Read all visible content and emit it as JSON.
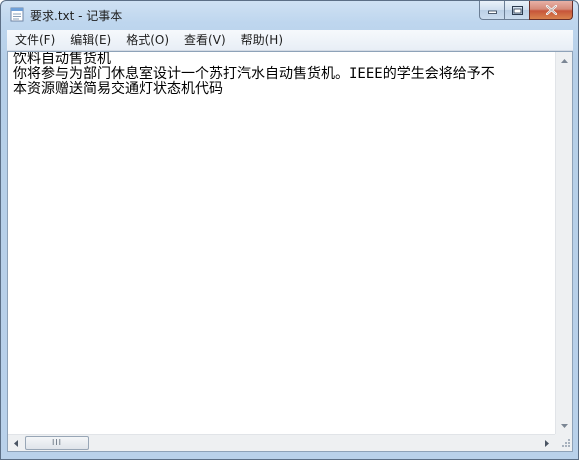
{
  "window": {
    "title": "要求.txt - 记事本"
  },
  "menubar": {
    "items": [
      {
        "label": "文件(F)"
      },
      {
        "label": "编辑(E)"
      },
      {
        "label": "格式(O)"
      },
      {
        "label": "查看(V)"
      },
      {
        "label": "帮助(H)"
      }
    ]
  },
  "document": {
    "lines": [
      "饮料自动售货机",
      "你将参与为部门休息室设计一个苏打汽水自动售货机。IEEE的学生会将给予不",
      "本资源赠送简易交通灯状态机代码"
    ]
  },
  "scrollbar": {
    "grip": "III"
  },
  "colors": {
    "frame": "#b9d1ea",
    "close_button": "#c7553a"
  }
}
